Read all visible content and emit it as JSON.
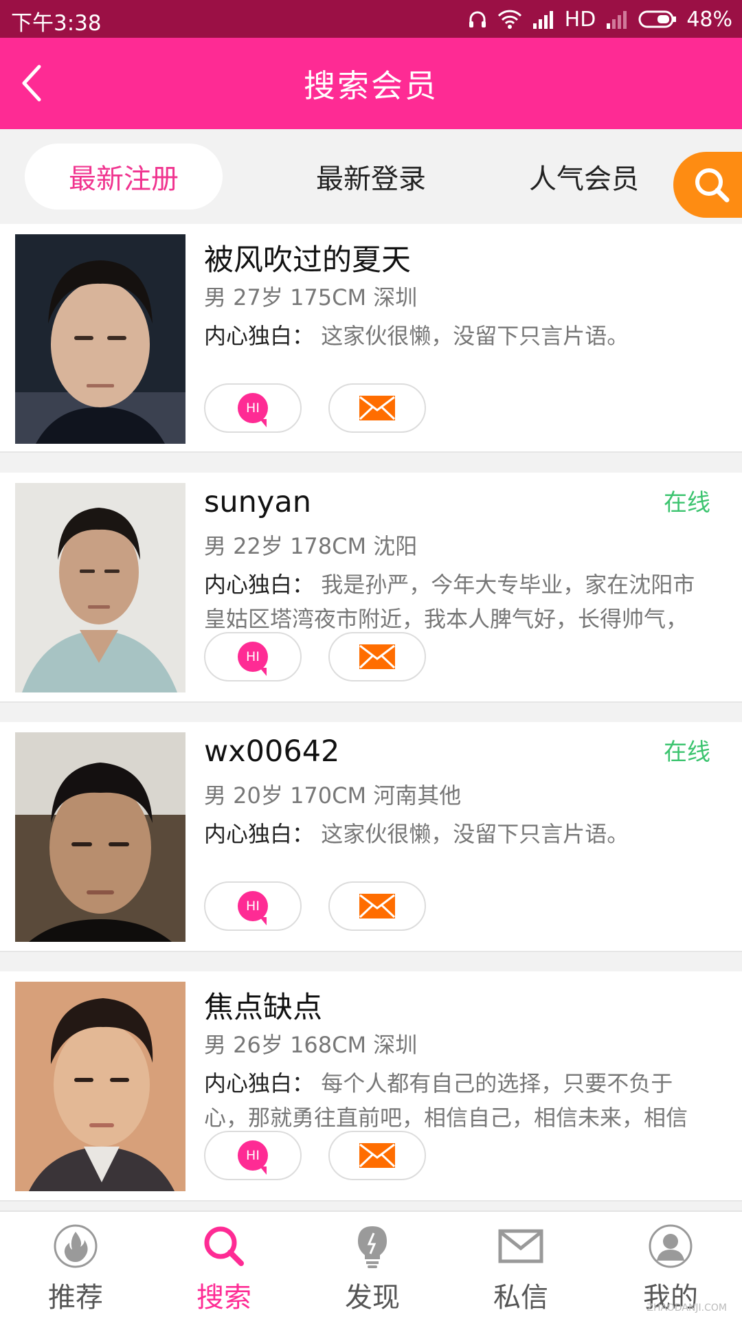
{
  "status_bar": {
    "time": "下午3:38",
    "network": "HD",
    "battery": "48%"
  },
  "header": {
    "title": "搜索会员"
  },
  "tabs": [
    {
      "label": "最新注册",
      "active": true
    },
    {
      "label": "最新登录",
      "active": false
    },
    {
      "label": "人气会员",
      "active": false
    }
  ],
  "monologue_label": "内心独白：",
  "hi_label": "HI",
  "members": [
    {
      "name": "被风吹过的夏天",
      "online": "",
      "meta": "男 27岁 175CM 深圳",
      "monologue": "这家伙很懒，没留下只言片语。"
    },
    {
      "name": "sunyan",
      "online": "在线",
      "meta": "男 22岁 178CM 沈阳",
      "monologue": "我是孙严，今年大专毕业，家在沈阳市皇姑区塔湾夜市附近，我本人脾气好，长得帅气，"
    },
    {
      "name": "wx00642",
      "online": "在线",
      "meta": "男 20岁 170CM 河南其他",
      "monologue": "这家伙很懒，没留下只言片语。"
    },
    {
      "name": "焦点缺点",
      "online": "",
      "meta": "男 26岁 168CM 深圳",
      "monologue": "每个人都有自己的选择，只要不负于心，那就勇往直前吧，相信自己，相信未来，相信"
    }
  ],
  "bottom_nav": [
    {
      "label": "推荐",
      "icon": "fire-icon",
      "active": false
    },
    {
      "label": "搜索",
      "icon": "search-icon",
      "active": true
    },
    {
      "label": "发现",
      "icon": "lightbulb-icon",
      "active": false
    },
    {
      "label": "私信",
      "icon": "mail-icon",
      "active": false
    },
    {
      "label": "我的",
      "icon": "user-icon",
      "active": false
    }
  ],
  "watermark": "ZHAODANJI.COM",
  "colors": {
    "brand_pink": "#fe2b94",
    "status_bar": "#9b1045",
    "accent_orange": "#fe8c12",
    "online_green": "#3cc46f"
  }
}
